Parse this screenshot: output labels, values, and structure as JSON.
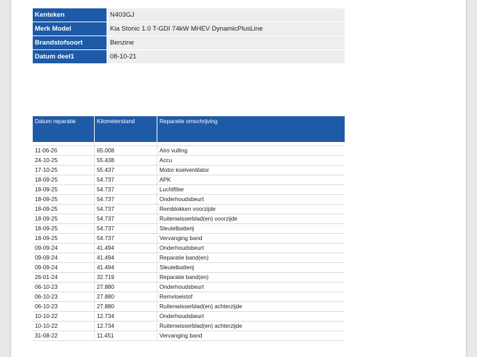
{
  "info": [
    {
      "label": "Kenteken",
      "value": "N403GJ"
    },
    {
      "label": "Merk Model",
      "value": "Kia Stonic 1.0 T-GDI 74kW MHEV DynamicPlusLine"
    },
    {
      "label": "Brandstofsoort",
      "value": "Benzine"
    },
    {
      "label": "Datum deel1",
      "value": "08-10-21"
    }
  ],
  "repairs": {
    "headers": [
      "Datum reparatie",
      "Kilometerstand",
      "Reparatie omschrijving"
    ],
    "rows": [
      [
        "11-06-26",
        "65.008",
        "Airo vulling"
      ],
      [
        "24-10-25",
        "55.438",
        "Accu"
      ],
      [
        "17-10-25",
        "55.437",
        "Motor koelventilator"
      ],
      [
        "18-09-25",
        "54.737",
        "APK"
      ],
      [
        "18-09-25",
        "54.737",
        "Luchtfilter"
      ],
      [
        "18-09-25",
        "54.737",
        "Onderhoudsbeurt"
      ],
      [
        "18-09-25",
        "54.737",
        "Remblokken voorzijde"
      ],
      [
        "18-09-25",
        "54.737",
        "Ruitenwisserblad(en) voorzijde"
      ],
      [
        "18-09-25",
        "54.737",
        "Sleutelbatterij"
      ],
      [
        "18-09-25",
        "54.737",
        "Vervanging band"
      ],
      [
        "09-09-24",
        "41.494",
        "Onderhoudsbeurt"
      ],
      [
        "09-09-24",
        "41.494",
        "Reparatie band(en)"
      ],
      [
        "09-09-24",
        "41.494",
        "Sleutelbatterij"
      ],
      [
        "26-01-24",
        "32.719",
        "Reparatie band(en)"
      ],
      [
        "06-10-23",
        "27.880",
        "Onderhoudsbeurt"
      ],
      [
        "06-10-23",
        "27.880",
        "Remvloeistof"
      ],
      [
        "06-10-23",
        "27.880",
        "Ruitenwisserblad(en) achterzijde"
      ],
      [
        "10-10-22",
        "12.734",
        "Onderhoudsbeurt"
      ],
      [
        "10-10-22",
        "12.734",
        "Ruitenwisserblad(en) achterzijde"
      ],
      [
        "31-08-22",
        "11.451",
        "Vervanging band"
      ]
    ]
  },
  "colors": {
    "header_blue": "#1e5aa8",
    "value_bg": "#eeeeee"
  }
}
